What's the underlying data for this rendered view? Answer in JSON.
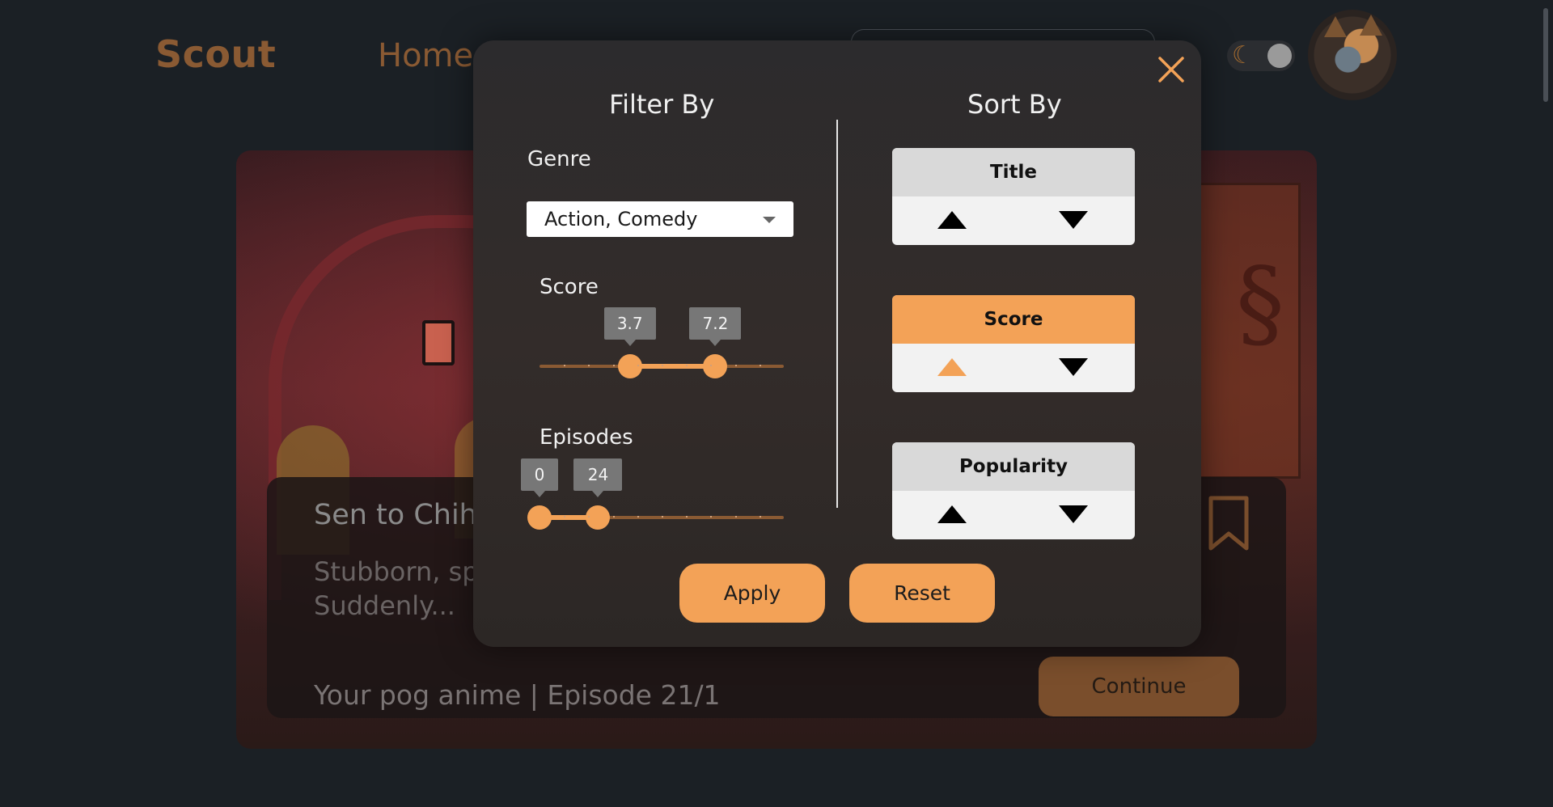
{
  "nav": {
    "logo": "Scout",
    "home": "Home"
  },
  "hero": {
    "title": "Sen to Chih",
    "description": "Stubborn, spo                                                                              pleased whe                                                                                          nt park on the way to their new house. Suddenly...",
    "footer": "Your pog anime | Episode 21/1",
    "continue_label": "Continue"
  },
  "modal": {
    "filter_heading": "Filter By",
    "sort_heading": "Sort By",
    "genre": {
      "label": "Genre",
      "value": "Action, Comedy"
    },
    "score": {
      "label": "Score",
      "min": 0,
      "max": 10,
      "low": 3.7,
      "high": 7.2,
      "low_text": "3.7",
      "high_text": "7.2"
    },
    "episodes": {
      "label": "Episodes",
      "min": 0,
      "max": 100,
      "low": 0,
      "high": 24,
      "low_text": "0",
      "high_text": "24"
    },
    "sort_options": [
      {
        "label": "Title",
        "active": false,
        "direction": null
      },
      {
        "label": "Score",
        "active": true,
        "direction": "asc"
      },
      {
        "label": "Popularity",
        "active": false,
        "direction": null
      }
    ],
    "apply_label": "Apply",
    "reset_label": "Reset"
  },
  "colors": {
    "accent": "#f3a257",
    "accent_dark": "#8a5a33",
    "background": "#1b2025"
  }
}
